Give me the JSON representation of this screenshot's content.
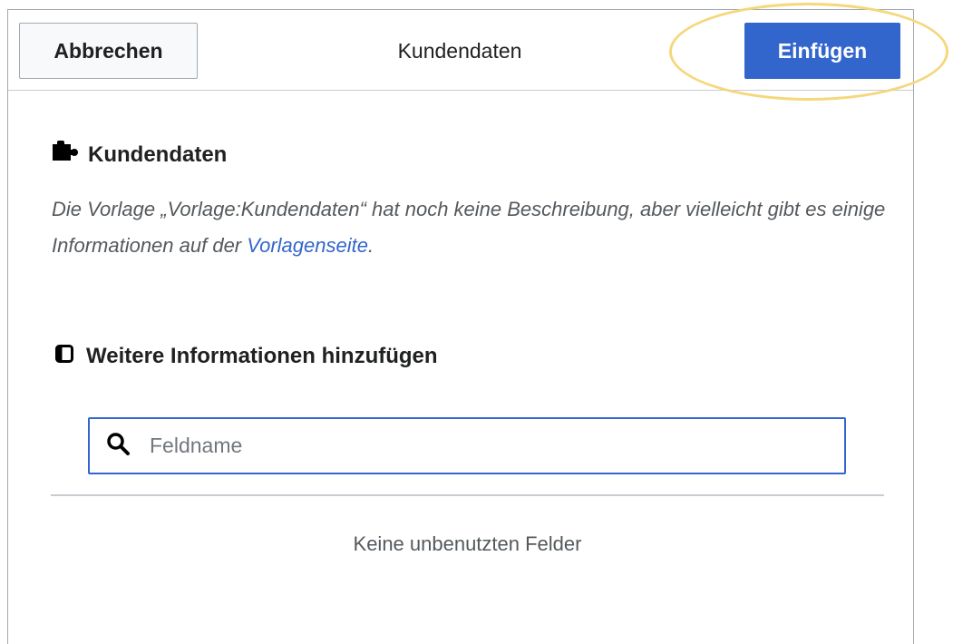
{
  "header": {
    "cancel_label": "Abbrechen",
    "title": "Kundendaten",
    "insert_label": "Einfügen"
  },
  "template": {
    "title": "Kundendaten",
    "icon": "puzzle-icon",
    "description_before": "Die Vorlage „Vorlage:Kundendaten“ hat noch keine Beschreibung, aber vielleicht gibt es einige Informationen auf der ",
    "description_link": "Vorlagenseite",
    "description_after": "."
  },
  "add_fields": {
    "heading": "Weitere Informationen hinzufügen",
    "icon": "add-field-icon",
    "search": {
      "icon": "search-icon",
      "placeholder": "Feldname",
      "value": ""
    },
    "empty_message": "Keine unbenutzten Felder"
  },
  "colors": {
    "progressive": "#3366cc",
    "highlight": "#f5d77c",
    "link": "#3366cc",
    "muted_text": "#54595d"
  }
}
